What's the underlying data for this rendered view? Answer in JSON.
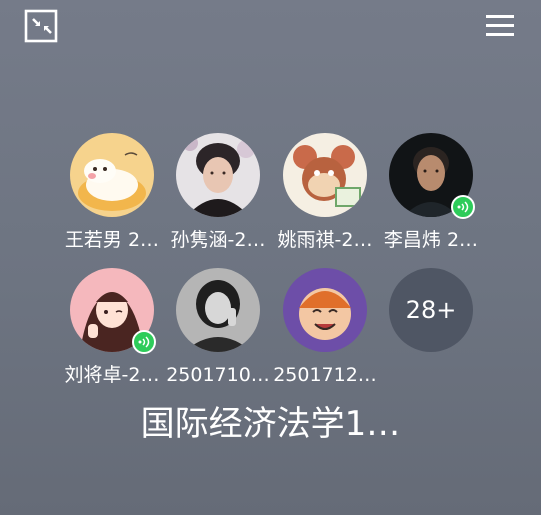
{
  "toolbar": {
    "minimize_icon": "minimize-window-icon",
    "menu_icon": "hamburger-menu-icon"
  },
  "participants": [
    {
      "name": "王若男 2…",
      "avatar": "cartoon-cat-on-pillow",
      "speaking": false
    },
    {
      "name": "孙隽涵-2…",
      "avatar": "young-man-photo",
      "speaking": false
    },
    {
      "name": "姚雨祺-2…",
      "avatar": "cartoon-mouse-reading",
      "speaking": false
    },
    {
      "name": "李昌炜 2…",
      "avatar": "man-dark-photo",
      "speaking": true
    },
    {
      "name": "刘将卓-2…",
      "avatar": "anime-girl-peace-sign",
      "speaking": true
    },
    {
      "name": "2501710…",
      "avatar": "woman-black-white-photo",
      "speaking": false
    },
    {
      "name": "2501712…",
      "avatar": "cartoon-face-laughing",
      "speaking": false
    }
  ],
  "more": {
    "label": "28+"
  },
  "meeting": {
    "title": "国际经济法学1…"
  },
  "colors": {
    "background": "#6f7683",
    "speaking_badge": "#2ecc5a",
    "more_bubble": "#4f5664"
  }
}
